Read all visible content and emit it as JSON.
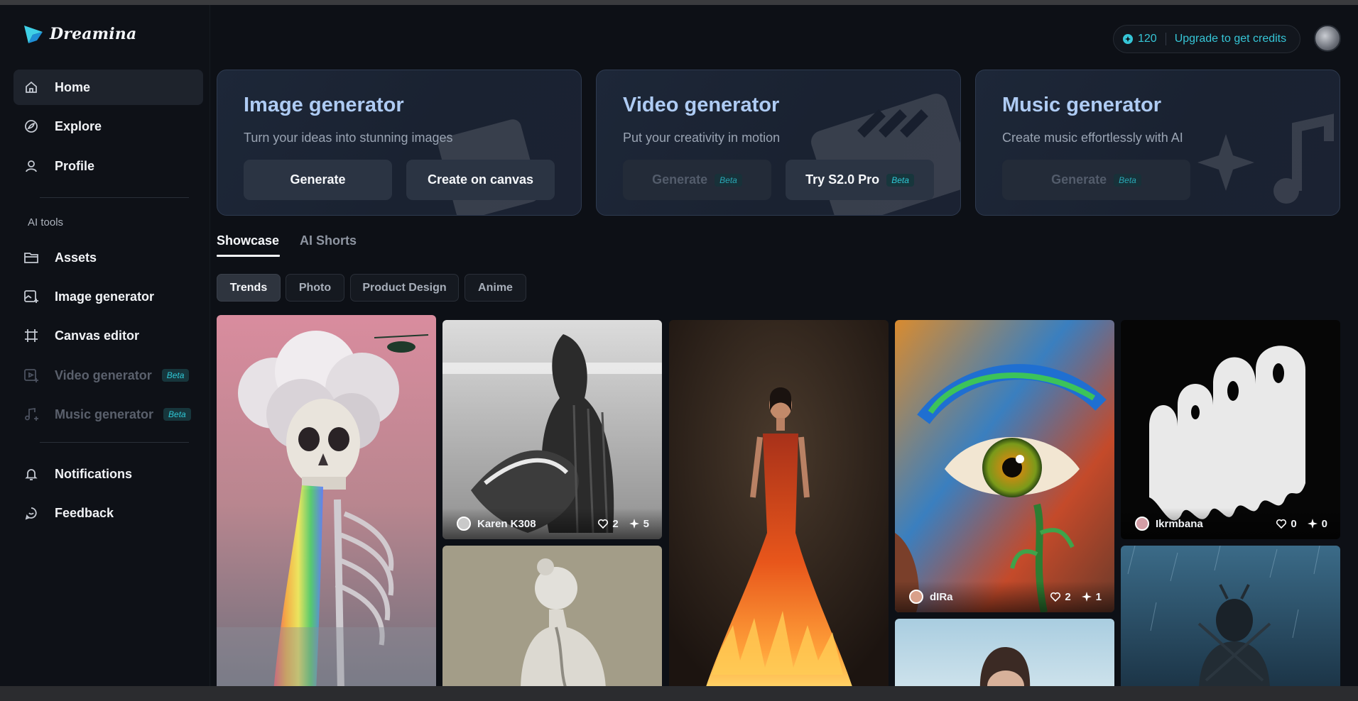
{
  "app": {
    "name": "Dreamina"
  },
  "header": {
    "credits_count": "120",
    "upgrade_label": "Upgrade to get credits"
  },
  "sidebar": {
    "items": [
      {
        "label": "Home",
        "icon": "home-icon"
      },
      {
        "label": "Explore",
        "icon": "explore-icon"
      },
      {
        "label": "Profile",
        "icon": "profile-icon"
      }
    ],
    "section_label": "AI tools",
    "tools": [
      {
        "label": "Assets",
        "icon": "folder-icon"
      },
      {
        "label": "Image generator",
        "icon": "image-generator-icon"
      },
      {
        "label": "Canvas editor",
        "icon": "canvas-icon"
      },
      {
        "label": "Video generator",
        "icon": "video-icon",
        "badge": "Beta",
        "disabled": true
      },
      {
        "label": "Music generator",
        "icon": "music-icon",
        "badge": "Beta",
        "disabled": true
      }
    ],
    "bottom": [
      {
        "label": "Notifications",
        "icon": "bell-icon"
      },
      {
        "label": "Feedback",
        "icon": "feedback-icon"
      }
    ]
  },
  "generators": [
    {
      "title": "Image generator",
      "subtitle": "Turn your ideas into stunning images",
      "buttons": [
        {
          "label": "Generate"
        },
        {
          "label": "Create on canvas"
        }
      ]
    },
    {
      "title": "Video generator",
      "subtitle": "Put your creativity in motion",
      "buttons": [
        {
          "label": "Generate",
          "badge": "Beta",
          "disabled": true
        },
        {
          "label": "Try S2.0 Pro",
          "badge": "Beta"
        }
      ]
    },
    {
      "title": "Music generator",
      "subtitle": "Create music effortlessly with AI",
      "buttons": [
        {
          "label": "Generate",
          "badge": "Beta",
          "disabled": true
        }
      ]
    }
  ],
  "tabs": [
    {
      "label": "Showcase",
      "active": true
    },
    {
      "label": "AI Shorts"
    }
  ],
  "filters": [
    {
      "label": "Trends",
      "active": true
    },
    {
      "label": "Photo"
    },
    {
      "label": "Product Design"
    },
    {
      "label": "Anime"
    }
  ],
  "gallery": [
    {
      "author": "Karen K308",
      "likes": "2",
      "remixes": "5"
    },
    {
      "author": "dIRa",
      "likes": "2",
      "remixes": "1"
    },
    {
      "author": "Ikrmbana",
      "likes": "0",
      "remixes": "0"
    }
  ],
  "colors": {
    "accent": "#36c6d7",
    "title_blue": "#aecbf3",
    "background": "#0d1016"
  }
}
